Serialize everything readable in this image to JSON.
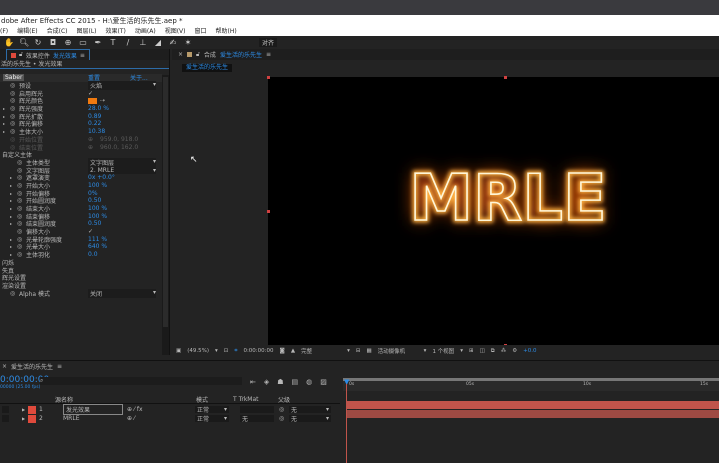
{
  "window": {
    "title": "dobe After Effects CC 2015 - H:\\爱生活的乐先生.aep *"
  },
  "menu": [
    "(F)",
    "编辑(E)",
    "合成(C)",
    "图层(L)",
    "效果(T)",
    "动画(A)",
    "视图(V)",
    "窗口",
    "帮助(H)"
  ],
  "toolbar": {
    "icons": [
      "hand-icon",
      "zoom-icon",
      "rotate-icon",
      "camera-icon",
      "pan-behind-icon",
      "rectangle-icon",
      "pen-icon",
      "text-icon",
      "brush-icon",
      "clone-stamp-icon",
      "eraser-icon",
      "roto-brush-icon",
      "puppet-pin-icon"
    ],
    "snap_label": "对齐"
  },
  "effects_panel": {
    "tab_title": "效果控件",
    "tab_layer": "发光效果",
    "breadcrumb": "活的乐先生 • 发光效果",
    "effect_name": "Saber",
    "reset_label": "重置",
    "about_label": "关于...",
    "rows": [
      {
        "name": "预设",
        "value": "火焰",
        "type": "dropdown",
        "indent": 1
      },
      {
        "name": "启用辉光",
        "value": "✓",
        "type": "check",
        "indent": 1
      },
      {
        "name": "辉光颜色",
        "value": "",
        "type": "color",
        "color": "#f07a10",
        "indent": 1
      },
      {
        "name": "辉光强度",
        "value": "28.0 %",
        "type": "num",
        "indent": 1,
        "arrow": true
      },
      {
        "name": "辉光扩散",
        "value": "0.89",
        "type": "num",
        "indent": 1,
        "arrow": true
      },
      {
        "name": "辉光偏移",
        "value": "0.22",
        "type": "num",
        "indent": 1,
        "arrow": true
      },
      {
        "name": "主体大小",
        "value": "10.38",
        "type": "num",
        "indent": 1,
        "arrow": true
      },
      {
        "name": "开始位置",
        "value": "959.0, 918.0",
        "type": "point",
        "indent": 1,
        "disabled": true
      },
      {
        "name": "结束位置",
        "value": "960.0, 162.0",
        "type": "point",
        "indent": 1,
        "disabled": true
      },
      {
        "name": "自定义主体",
        "value": "",
        "type": "group",
        "indent": 0
      },
      {
        "name": "主体类型",
        "value": "文字图层",
        "type": "dropdown",
        "indent": 2
      },
      {
        "name": "文字图层",
        "value": "2. MRLE",
        "type": "dropdown",
        "indent": 2
      },
      {
        "name": "遮罩演变",
        "value": "0x +0.0°",
        "type": "num",
        "indent": 2,
        "arrow": true
      },
      {
        "name": "开始大小",
        "value": "100 %",
        "type": "num",
        "indent": 2,
        "arrow": true
      },
      {
        "name": "开始偏移",
        "value": "0%",
        "type": "num",
        "indent": 2,
        "arrow": true
      },
      {
        "name": "开始圆润度",
        "value": "0.50",
        "type": "num",
        "indent": 2,
        "arrow": true
      },
      {
        "name": "结束大小",
        "value": "100 %",
        "type": "num",
        "indent": 2,
        "arrow": true
      },
      {
        "name": "结束偏移",
        "value": "100 %",
        "type": "num",
        "indent": 2,
        "arrow": true
      },
      {
        "name": "结束圆润度",
        "value": "0.50",
        "type": "num",
        "indent": 2,
        "arrow": true
      },
      {
        "name": "偏移大小",
        "value": "✓",
        "type": "check",
        "indent": 2
      },
      {
        "name": "光晕轮廓强度",
        "value": "111 %",
        "type": "num",
        "indent": 2,
        "arrow": true
      },
      {
        "name": "光晕大小",
        "value": "640 %",
        "type": "num",
        "indent": 2,
        "arrow": true
      },
      {
        "name": "主体羽化",
        "value": "0.0",
        "type": "num",
        "indent": 2,
        "arrow": true
      },
      {
        "name": "闪烁",
        "value": "",
        "type": "group",
        "indent": 0
      },
      {
        "name": "失真",
        "value": "",
        "type": "group",
        "indent": 0
      },
      {
        "name": "辉光设置",
        "value": "",
        "type": "group",
        "indent": 0
      },
      {
        "name": "渲染设置",
        "value": "",
        "type": "group",
        "indent": 0
      },
      {
        "name": "Alpha 模式",
        "value": "关闭",
        "type": "dropdown",
        "indent": 1
      }
    ]
  },
  "comp_panel": {
    "tab_prefix": "合成",
    "tab_name": "爱生活的乐先生",
    "comp_chip": "爱生活的乐先生",
    "render_text": "MRLE"
  },
  "viewer_toolbar": {
    "zoom": "(49.5%)",
    "timecode": "0:00:00:00",
    "channel": "完整",
    "camera": "活动摄像机",
    "views": "1 个视图",
    "exposure": "+0.0"
  },
  "timeline": {
    "comp_name": "爱生活的乐先生",
    "timecode": "0:00:00:00",
    "fps": "00000 (25.00 fps)",
    "col_source": "源名称",
    "col_mode": "模式",
    "col_trkmat": "T  TrkMat",
    "col_parent": "父级",
    "ruler": [
      "0s",
      "05s",
      "10s",
      "15s"
    ],
    "layers": [
      {
        "num": "1",
        "name": "发光效果",
        "mode": "正常",
        "trkmat": "",
        "parent": "无",
        "color": "#e04a3c"
      },
      {
        "num": "2",
        "name": "MRLE",
        "mode": "正常",
        "trkmat": "无",
        "parent": "无",
        "color": "#e04a3c"
      }
    ]
  },
  "colors": {
    "accent": "#2d8ce6",
    "layer_bar": "#c0544b",
    "glow": "#f07a10"
  }
}
